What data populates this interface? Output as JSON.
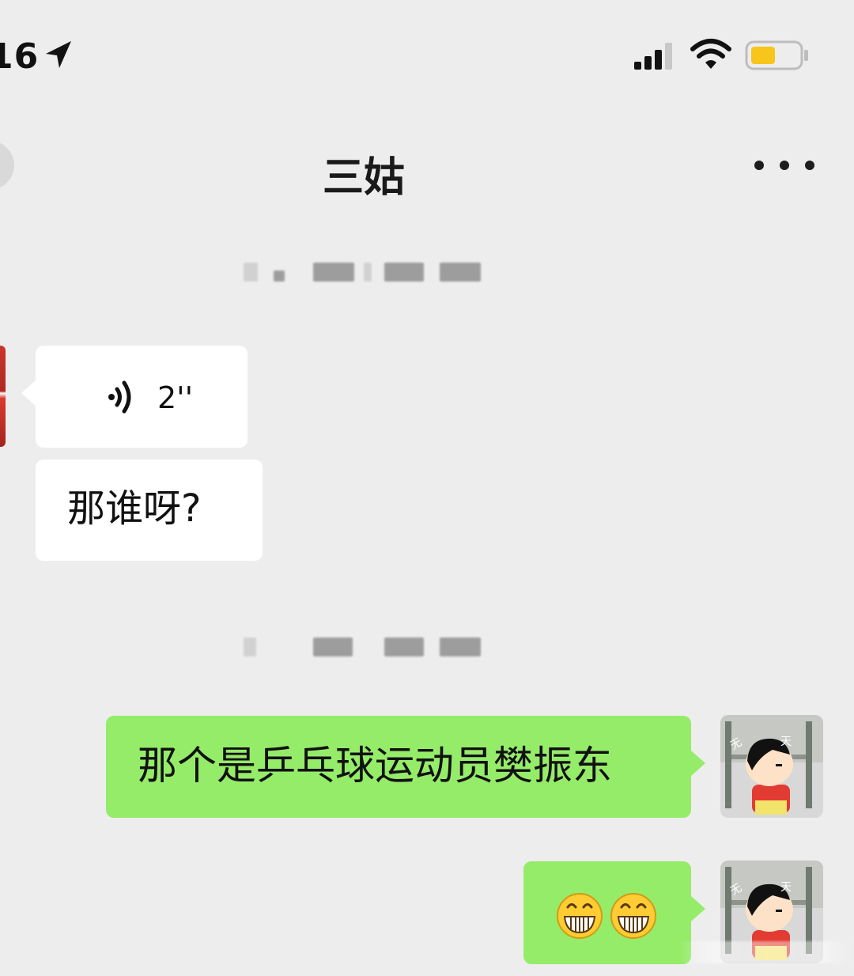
{
  "status_bar": {
    "time": "16"
  },
  "header": {
    "title": "三姑"
  },
  "messages": [
    {
      "side": "incoming",
      "type": "voice",
      "duration": "2''"
    },
    {
      "side": "incoming",
      "type": "text",
      "text": "那谁呀?"
    },
    {
      "side": "outgoing",
      "type": "text",
      "text": "那个是乒乓球运动员樊振东"
    },
    {
      "side": "outgoing",
      "type": "emoji",
      "emoji": [
        "grinning-face",
        "grinning-face"
      ]
    }
  ],
  "colors": {
    "background": "#ededed",
    "incoming_bubble": "#ffffff",
    "outgoing_bubble": "#95ec69"
  }
}
